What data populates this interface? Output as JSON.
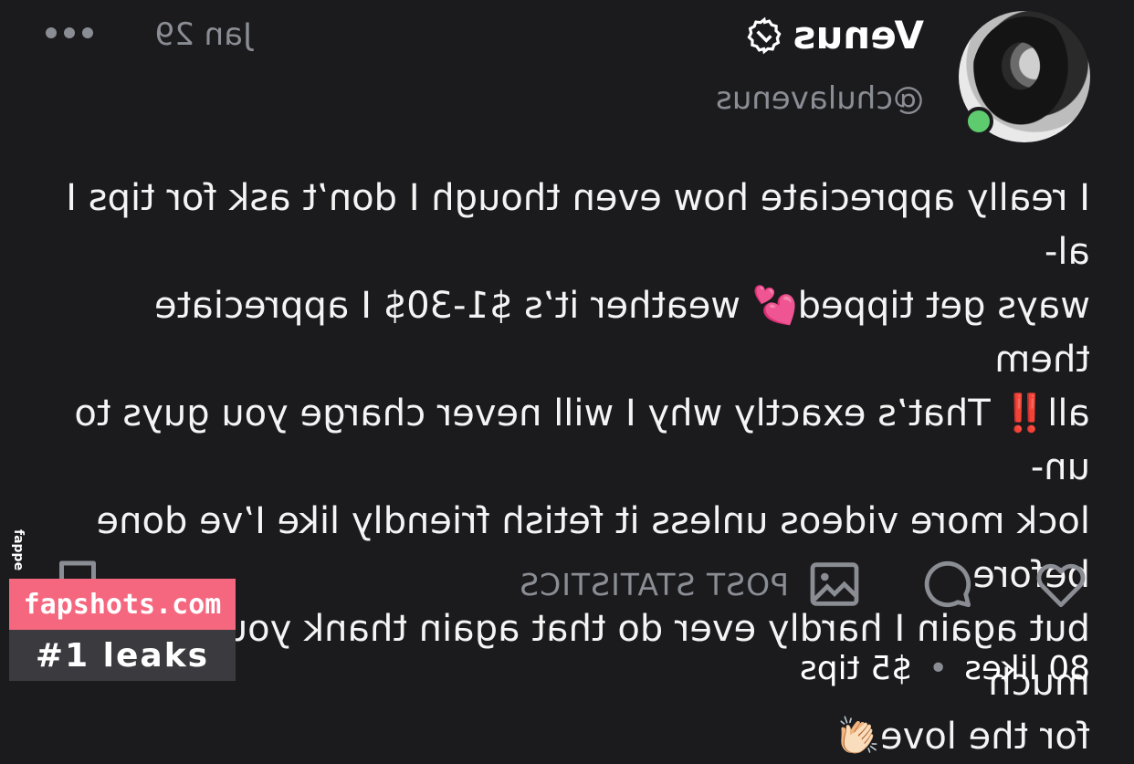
{
  "post": {
    "author_name": "Venus",
    "handle": "@chulavenus",
    "date": "Jan 29",
    "body": "I really appreciate how even though I don’t ask for tips I al-\nways get tipped💕 weather it’s $1-30$ I appreciate them\nall‼️ That’s exactly why I will never charge you guys to un-\nlock more videos unless it fetish friendly like I’ve done before\nbut again I hardly ever do that again thank you guys so much\nfor the love👏🏻",
    "post_statistics_label": "POST STATISTICS",
    "likes": "80 likes",
    "separator": "•",
    "tips": "$5 tips"
  },
  "icons": {
    "verified": "verified-badge-icon",
    "more": "more-dots-icon",
    "like": "heart-icon",
    "comment": "comment-icon",
    "stats": "image-stats-icon",
    "bookmark": "bookmark-icon"
  },
  "colors": {
    "background": "#1b1b1e",
    "muted": "#8a8d93",
    "online": "#5ecb6f",
    "watermark_pink": "#f4677f"
  },
  "watermark": {
    "site": "fapshots.com",
    "tagline": "#1 leaks",
    "vertical": "fappe"
  }
}
